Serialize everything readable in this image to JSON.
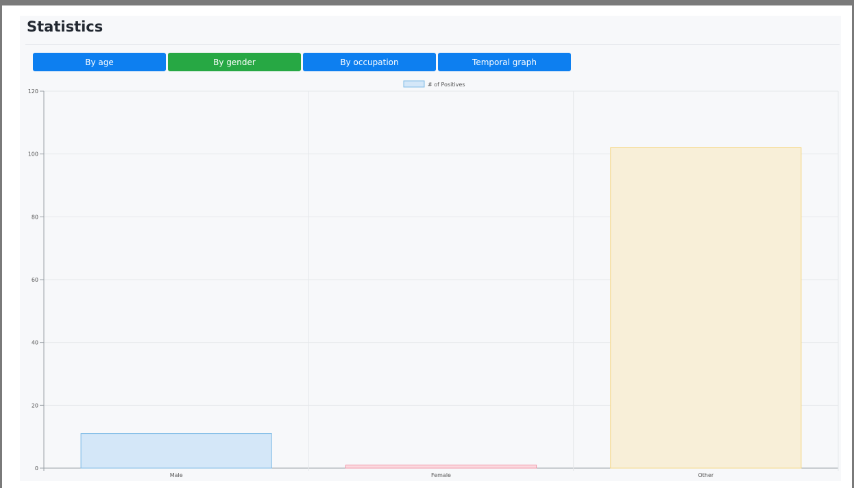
{
  "page": {
    "title": "Statistics"
  },
  "tabs": [
    {
      "label": "By age",
      "active": false
    },
    {
      "label": "By gender",
      "active": true
    },
    {
      "label": "By occupation",
      "active": false
    },
    {
      "label": "Temporal graph",
      "active": false
    }
  ],
  "colors": {
    "tab_default": "#0d7ff0",
    "tab_active": "#27a844",
    "grid": "#e6e8eb",
    "axis": "#9aa0a6",
    "tick_text": "#555555"
  },
  "chart_data": {
    "type": "bar",
    "categories": [
      "Male",
      "Female",
      "Other"
    ],
    "series": [
      {
        "name": "# of Positives",
        "values": [
          11,
          1,
          102
        ]
      }
    ],
    "bar_colors": [
      {
        "fill": "#d4e7f8",
        "stroke": "#7fbbe6"
      },
      {
        "fill": "#fbd9df",
        "stroke": "#f29aab"
      },
      {
        "fill": "#f8efd8",
        "stroke": "#f5d98a"
      }
    ],
    "legend": {
      "position": "top",
      "swatch_fill": "#d4e7f8",
      "swatch_stroke": "#7fbbe6"
    },
    "yticks": [
      0,
      20,
      40,
      60,
      80,
      100,
      120
    ],
    "ylim": [
      0,
      120
    ],
    "grid": true
  }
}
